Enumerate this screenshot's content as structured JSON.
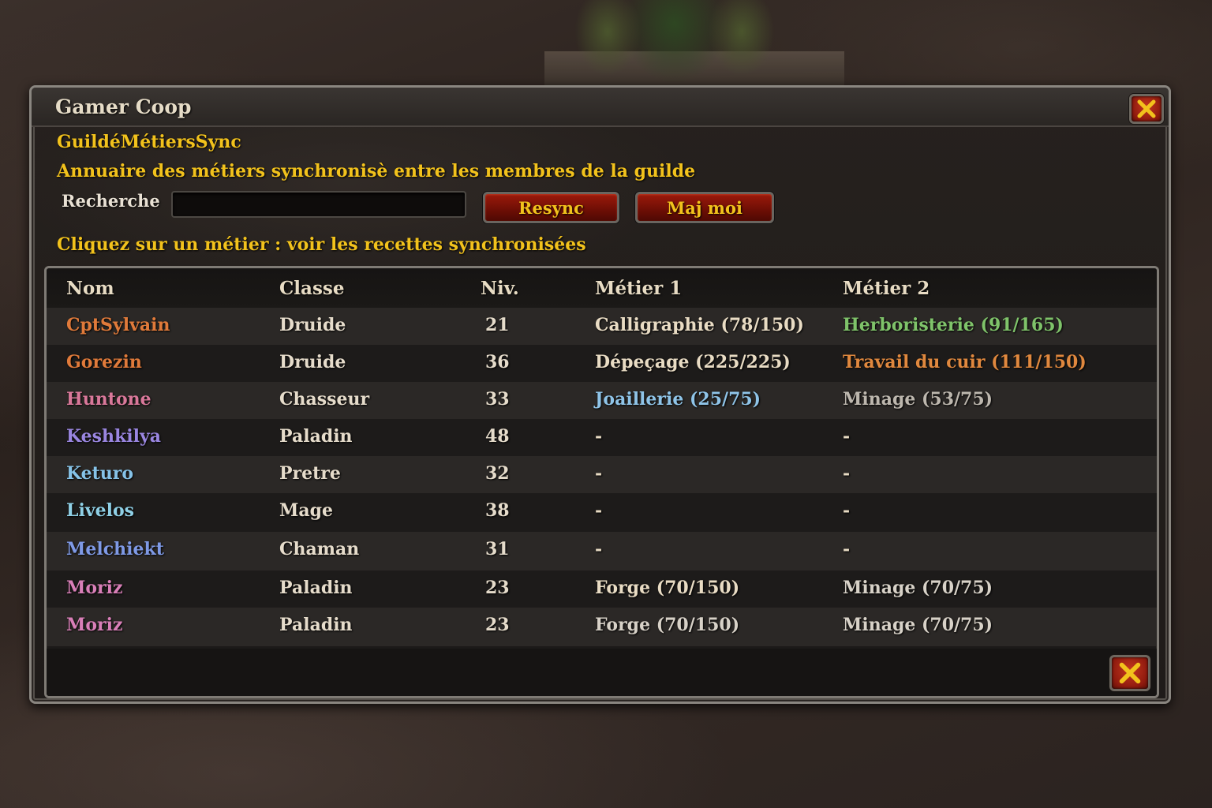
{
  "window": {
    "title": "Gamer Coop",
    "addon_name": "GuildéMétiersSync",
    "description": "Annuaire des métiers synchronisè entre les membres de la guilde",
    "hint": "Cliquez sur un métier : voir les recettes synchronisées"
  },
  "search": {
    "label": "Recherche",
    "value": "",
    "placeholder": ""
  },
  "buttons": {
    "resync": "Resync",
    "maj_moi": "Maj moi"
  },
  "table": {
    "headers": {
      "name": "Nom",
      "class": "Classe",
      "level": "Niv.",
      "job1": "Métier 1",
      "job2": "Métier 2"
    },
    "rows": [
      {
        "name": "CptSylvain",
        "name_color": "#e07a3a",
        "class": "Druide",
        "level": "21",
        "job1": "Calligraphie (78/150)",
        "job1_color": "#e9dcc4",
        "job2": "Herboristerie (91/165)",
        "job2_color": "#7fc36a"
      },
      {
        "name": "Gorezin",
        "name_color": "#e07a3a",
        "class": "Druide",
        "level": "36",
        "job1": "Dépeçage (225/225)",
        "job1_color": "#e9dcc4",
        "job2": "Travail du cuir (111/150)",
        "job2_color": "#e0883e"
      },
      {
        "name": "Huntone",
        "name_color": "#d9789a",
        "class": "Chasseur",
        "level": "33",
        "job1": "Joaillerie (25/75)",
        "job1_color": "#8fc4e8",
        "job2": "Minage (53/75)",
        "job2_color": "#bdb7ae"
      },
      {
        "name": "Keshkilya",
        "name_color": "#9a86e0",
        "class": "Paladin",
        "level": "48",
        "job1": "-",
        "job1_color": "#e9dcc4",
        "job2": "-",
        "job2_color": "#e9dcc4"
      },
      {
        "name": "Keturo",
        "name_color": "#86c3e8",
        "class": "Pretre",
        "level": "32",
        "job1": "-",
        "job1_color": "#e9dcc4",
        "job2": "-",
        "job2_color": "#e9dcc4"
      },
      {
        "name": "Livelos",
        "name_color": "#8fd0e6",
        "class": "Mage",
        "level": "38",
        "job1": "-",
        "job1_color": "#e9dcc4",
        "job2": "-",
        "job2_color": "#e9dcc4"
      },
      {
        "name": "Melchiekt",
        "name_color": "#7f9ae6",
        "class": "Chaman",
        "level": "31",
        "job1": "-",
        "job1_color": "#e9dcc4",
        "job2": "-",
        "job2_color": "#e9dcc4"
      },
      {
        "name": "Moriz",
        "name_color": "#d97fb8",
        "class": "Paladin",
        "level": "23",
        "job1": "Forge (70/150)",
        "job1_color": "#e9dcc4",
        "job2": "Minage (70/75)",
        "job2_color": "#d8d2c8"
      },
      {
        "name": "Moriz",
        "name_color": "#d97fb8",
        "class": "Paladin",
        "level": "23",
        "job1": "Forge (70/150)",
        "job1_color": "#d8d2c8",
        "job2": "Minage (70/75)",
        "job2_color": "#d8d2c8"
      }
    ]
  },
  "icons": {
    "close": "close-icon"
  }
}
